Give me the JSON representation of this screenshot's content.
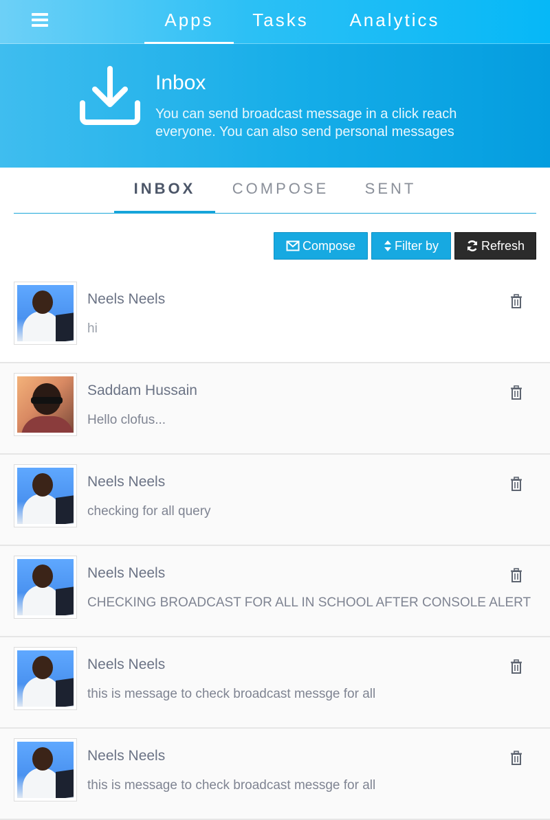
{
  "top_nav": {
    "items": [
      {
        "label": "Apps",
        "active": true
      },
      {
        "label": "Tasks",
        "active": false
      },
      {
        "label": "Analytics",
        "active": false
      }
    ]
  },
  "hero": {
    "title": "Inbox",
    "description": "You can send broadcast message in a click reach everyone. You can also send personal messages",
    "icon": "download-icon"
  },
  "tabs": [
    {
      "label": "INBOX",
      "active": true
    },
    {
      "label": "COMPOSE",
      "active": false
    },
    {
      "label": "SENT",
      "active": false
    }
  ],
  "toolbar": {
    "compose_label": "Compose",
    "filter_label": "Filter by",
    "refresh_label": "Refresh"
  },
  "messages": [
    {
      "name": "Neels Neels",
      "text": "hi",
      "avatar": "blue"
    },
    {
      "name": "Saddam Hussain",
      "text": "Hello clofus...",
      "avatar": "warm"
    },
    {
      "name": "Neels Neels",
      "text": "checking for all query",
      "avatar": "blue"
    },
    {
      "name": "Neels Neels",
      "text": "CHECKING BROADCAST FOR ALL IN SCHOOL AFTER CONSOLE ALERT",
      "avatar": "blue"
    },
    {
      "name": "Neels Neels",
      "text": "this is message to check broadcast messge for all",
      "avatar": "blue"
    },
    {
      "name": "Neels Neels",
      "text": "this is message to check broadcast messge for all",
      "avatar": "blue"
    }
  ],
  "colors": {
    "accent": "#17a9e1",
    "dark_button": "#2b2b2b",
    "text_name": "#6b7385"
  }
}
